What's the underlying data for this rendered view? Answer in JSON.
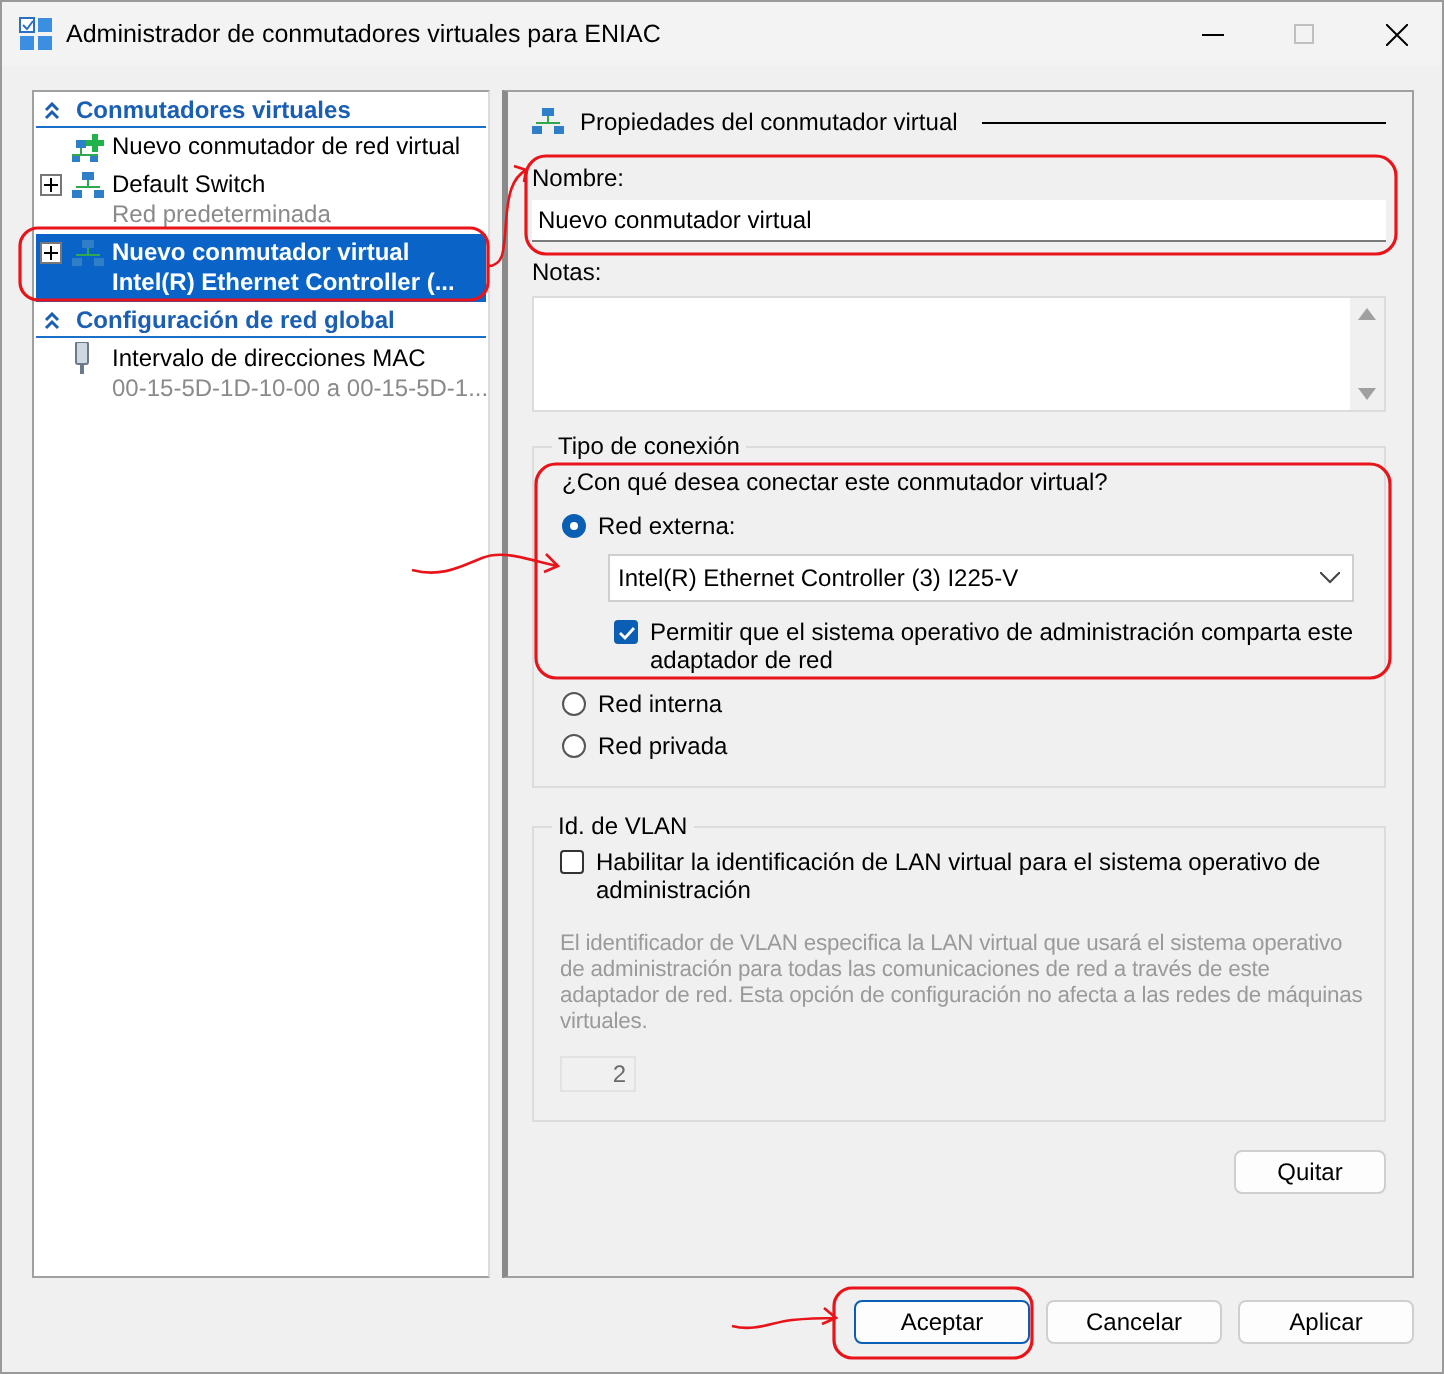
{
  "window": {
    "title": "Administrador de conmutadores virtuales para ENIAC"
  },
  "tree": {
    "sections": [
      {
        "title": "Conmutadores virtuales",
        "expanded": true,
        "items": [
          {
            "kind": "add",
            "label": "Nuevo conmutador de red virtual",
            "expandable": false,
            "selected": false
          },
          {
            "kind": "switch",
            "label": "Default Switch",
            "sublabel": "Red predeterminada",
            "expandable": true,
            "selected": false
          },
          {
            "kind": "switch",
            "label": "Nuevo conmutador virtual",
            "sublabel": "Intel(R) Ethernet Controller (...",
            "expandable": true,
            "selected": true
          }
        ]
      },
      {
        "title": "Configuración de red global",
        "expanded": true,
        "items": [
          {
            "kind": "mac",
            "label": "Intervalo de direcciones MAC",
            "sublabel": "00-15-5D-1D-10-00 a 00-15-5D-1...",
            "expandable": false,
            "selected": false
          }
        ]
      }
    ]
  },
  "properties": {
    "title": "Propiedades del conmutador virtual",
    "name_label": "Nombre:",
    "name_value": "Nuevo conmutador virtual",
    "notes_label": "Notas:"
  },
  "connection": {
    "legend": "Tipo de conexión",
    "question": "¿Con qué desea conectar este conmutador virtual?",
    "options": [
      {
        "label": "Red externa:",
        "selected": true
      },
      {
        "label": "Red interna",
        "selected": false
      },
      {
        "label": "Red privada",
        "selected": false
      }
    ],
    "adapter": "Intel(R) Ethernet Controller (3) I225-V",
    "share": {
      "label": "Permitir que el sistema operativo de administración comparta este adaptador de red",
      "checked": true
    }
  },
  "vlan": {
    "legend": "Id. de VLAN",
    "enable": {
      "label": "Habilitar la identificación de LAN virtual para el sistema operativo de administración",
      "checked": false
    },
    "description": "El identificador de VLAN especifica la LAN virtual que usará el sistema operativo de administración para todas las comunicaciones de red a través de este adaptador de red. Esta opción de configuración no afecta a las redes de máquinas virtuales.",
    "value": "2",
    "disabled": true
  },
  "remove_button": "Quitar",
  "buttons": [
    {
      "label": "Aceptar",
      "default": true
    },
    {
      "label": "Cancelar",
      "default": false
    },
    {
      "label": "Aplicar",
      "default": false
    }
  ]
}
